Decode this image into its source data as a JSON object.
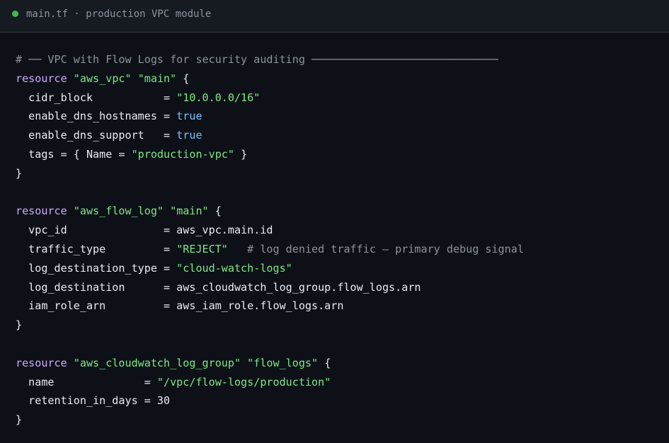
{
  "window": {
    "tab_title": "main.tf · production VPC module",
    "status_dot_color": "#3fb950"
  },
  "colors": {
    "background": "#0d1117",
    "keyword": "#d2a8ff",
    "string": "#7ee787",
    "boolean": "#79c0ff",
    "comment": "#8b949e",
    "text": "#e6edf3"
  },
  "code": {
    "lines": [
      [
        {
          "t": "cmt",
          "v": "# ── VPC with Flow Logs for security auditing ─────────────────────────────"
        }
      ],
      [
        {
          "t": "kw",
          "v": "resource"
        },
        {
          "t": "punc",
          "v": " "
        },
        {
          "t": "str",
          "v": "\"aws_vpc\""
        },
        {
          "t": "punc",
          "v": " "
        },
        {
          "t": "str",
          "v": "\"main\""
        },
        {
          "t": "punc",
          "v": " {"
        }
      ],
      [
        {
          "t": "punc",
          "v": "  cidr_block           = "
        },
        {
          "t": "str",
          "v": "\"10.0.0.0/16\""
        }
      ],
      [
        {
          "t": "punc",
          "v": "  enable_dns_hostnames = "
        },
        {
          "t": "bool",
          "v": "true"
        }
      ],
      [
        {
          "t": "punc",
          "v": "  enable_dns_support   = "
        },
        {
          "t": "bool",
          "v": "true"
        }
      ],
      [
        {
          "t": "punc",
          "v": "  tags = { Name = "
        },
        {
          "t": "str",
          "v": "\"production-vpc\""
        },
        {
          "t": "punc",
          "v": " }"
        }
      ],
      [
        {
          "t": "punc",
          "v": "}"
        }
      ],
      [],
      [
        {
          "t": "kw",
          "v": "resource"
        },
        {
          "t": "punc",
          "v": " "
        },
        {
          "t": "str",
          "v": "\"aws_flow_log\""
        },
        {
          "t": "punc",
          "v": " "
        },
        {
          "t": "str",
          "v": "\"main\""
        },
        {
          "t": "punc",
          "v": " {"
        }
      ],
      [
        {
          "t": "punc",
          "v": "  vpc_id               = aws_vpc.main.id"
        }
      ],
      [
        {
          "t": "punc",
          "v": "  traffic_type         = "
        },
        {
          "t": "str",
          "v": "\"REJECT\""
        },
        {
          "t": "punc",
          "v": "   "
        },
        {
          "t": "cmt",
          "v": "# log denied traffic — primary debug signal"
        }
      ],
      [
        {
          "t": "punc",
          "v": "  log_destination_type = "
        },
        {
          "t": "str",
          "v": "\"cloud-watch-logs\""
        }
      ],
      [
        {
          "t": "punc",
          "v": "  log_destination      = aws_cloudwatch_log_group.flow_logs.arn"
        }
      ],
      [
        {
          "t": "punc",
          "v": "  iam_role_arn         = aws_iam_role.flow_logs.arn"
        }
      ],
      [
        {
          "t": "punc",
          "v": "}"
        }
      ],
      [],
      [
        {
          "t": "kw",
          "v": "resource"
        },
        {
          "t": "punc",
          "v": " "
        },
        {
          "t": "str",
          "v": "\"aws_cloudwatch_log_group\""
        },
        {
          "t": "punc",
          "v": " "
        },
        {
          "t": "str",
          "v": "\"flow_logs\""
        },
        {
          "t": "punc",
          "v": " {"
        }
      ],
      [
        {
          "t": "punc",
          "v": "  name              = "
        },
        {
          "t": "str",
          "v": "\"/vpc/flow-logs/production\""
        }
      ],
      [
        {
          "t": "punc",
          "v": "  retention_in_days = "
        },
        {
          "t": "num",
          "v": "30"
        }
      ],
      [
        {
          "t": "punc",
          "v": "}"
        }
      ]
    ]
  }
}
